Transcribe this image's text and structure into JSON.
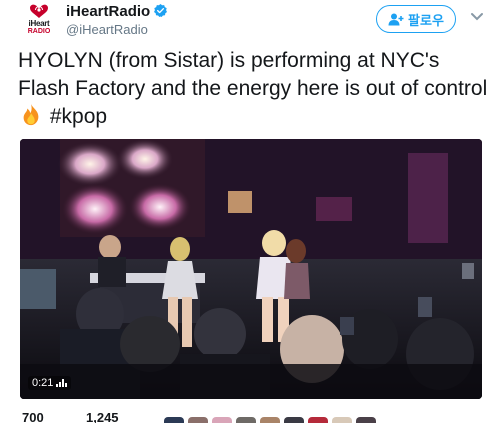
{
  "account": {
    "avatar_line1": "iHeart",
    "avatar_line2": "RADIO",
    "display_name": "iHeartRadio",
    "handle": "@iHeartRadio"
  },
  "follow": {
    "label": "팔로우"
  },
  "tweet": {
    "text_main": "HYOLYN (from Sistar) is performing at NYC's Flash Factory and the energy here is out of control ",
    "hashtag": " #kpop"
  },
  "video": {
    "timestamp": "0:21"
  },
  "stats": {
    "retweets": "700",
    "likes": "1,245"
  },
  "colors": {
    "accent": "#1da1f2",
    "brand_red": "#c6002b",
    "text": "#14171a",
    "muted": "#657786"
  },
  "icons": [
    "iheartradio-logo",
    "verified-badge-icon",
    "follow-person-icon",
    "chevron-down-icon",
    "fire-emoji-icon",
    "audio-bars-icon"
  ]
}
